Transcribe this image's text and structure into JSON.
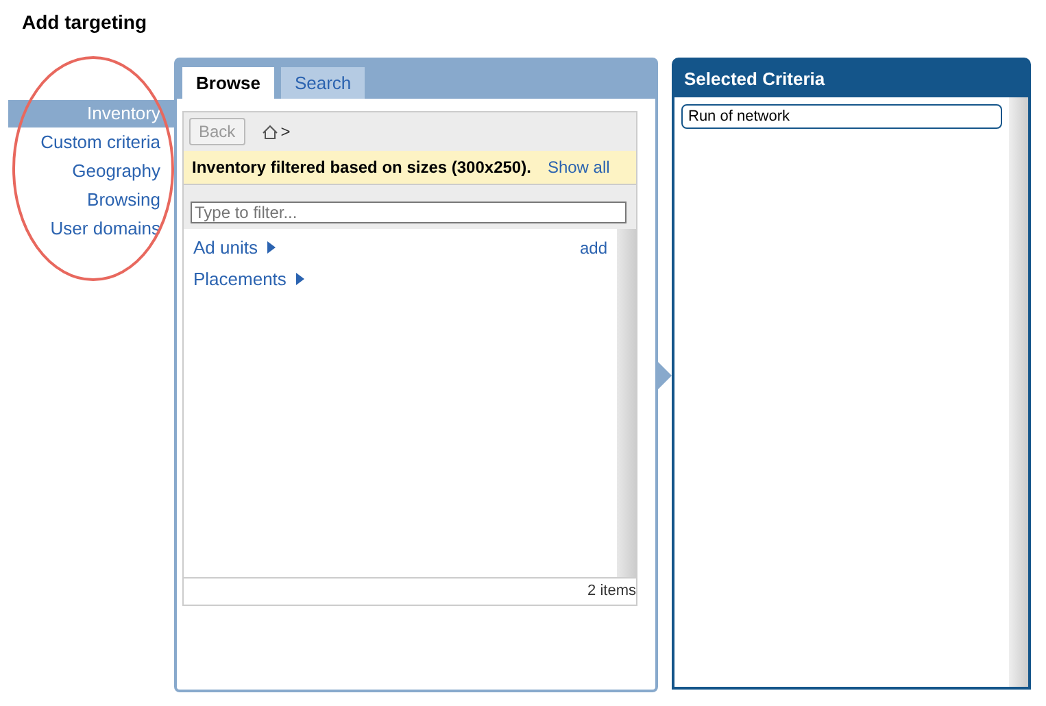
{
  "title": "Add targeting",
  "sidebar": {
    "items": [
      {
        "label": "Inventory",
        "selected": true
      },
      {
        "label": "Custom criteria",
        "selected": false
      },
      {
        "label": "Geography",
        "selected": false
      },
      {
        "label": "Browsing",
        "selected": false
      },
      {
        "label": "User domains",
        "selected": false
      }
    ]
  },
  "tabs": [
    {
      "label": "Browse",
      "selected": true
    },
    {
      "label": "Search",
      "selected": false
    }
  ],
  "browser": {
    "back": {
      "label": "Back",
      "disabled": true
    },
    "breadcrumb_separator": ">",
    "notice": {
      "text": "Inventory filtered based on sizes (300x250).",
      "link": "Show all"
    },
    "filter": {
      "placeholder": "Type to filter..."
    },
    "items": [
      {
        "label": "Ad units",
        "action": "add"
      },
      {
        "label": "Placements"
      }
    ],
    "count": "2 items"
  },
  "selected_criteria": {
    "title": "Selected Criteria",
    "items": [
      "Run of network"
    ]
  }
}
